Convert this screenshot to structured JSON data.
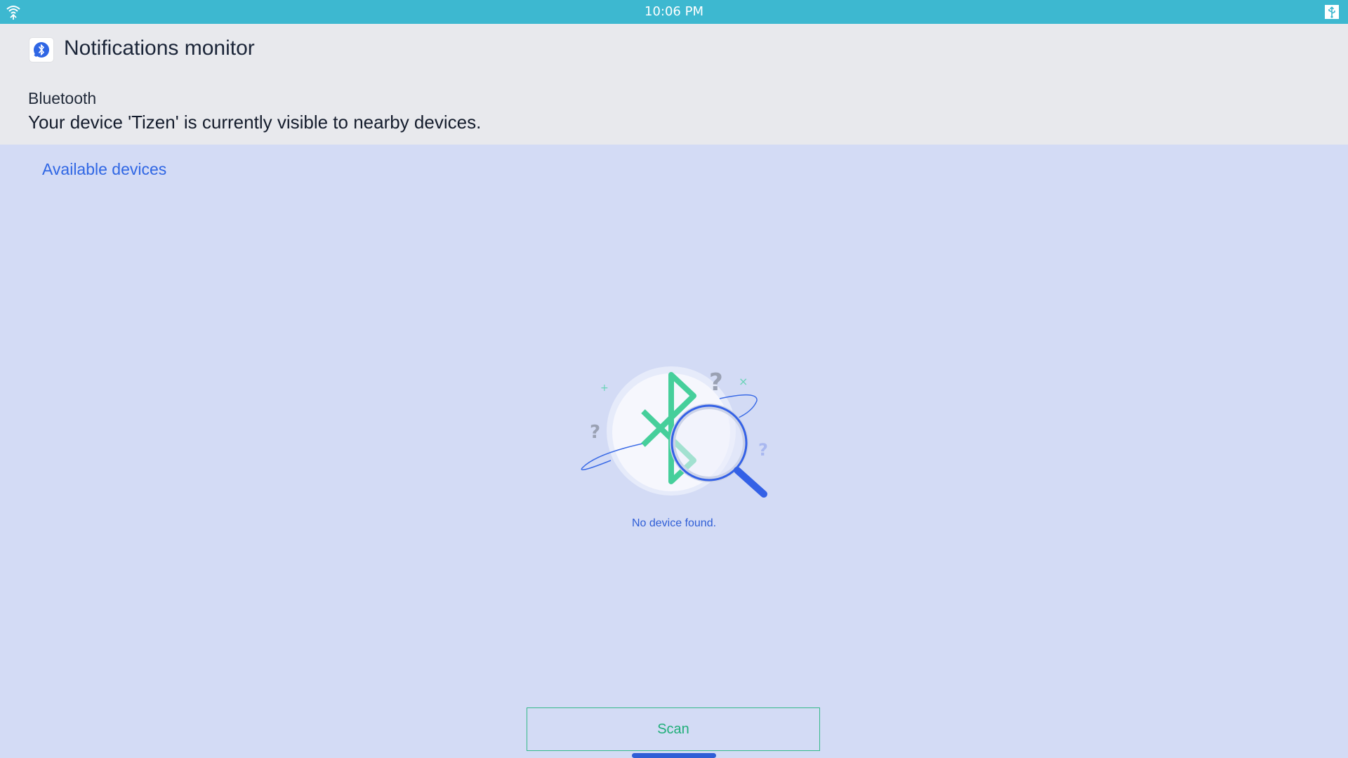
{
  "status_bar": {
    "time": "10:06 PM",
    "left_icon": "wifi-icon",
    "right_icon": "usb-icon"
  },
  "header": {
    "app_icon": "bluetooth-app-icon",
    "title": "Notifications monitor",
    "bluetooth_label": "Bluetooth",
    "visibility_text": "Your device 'Tizen' is currently visible to nearby devices."
  },
  "main": {
    "section_title": "Available devices",
    "illustration_icon": "bluetooth-search-icon",
    "empty_text": "No device found.",
    "scan_label": "Scan"
  },
  "colors": {
    "status_bar": "#3db8d0",
    "header_bg": "#e8e9ed",
    "main_bg": "#d3dbf5",
    "accent_blue": "#2f66e4",
    "accent_green": "#35b98a"
  }
}
